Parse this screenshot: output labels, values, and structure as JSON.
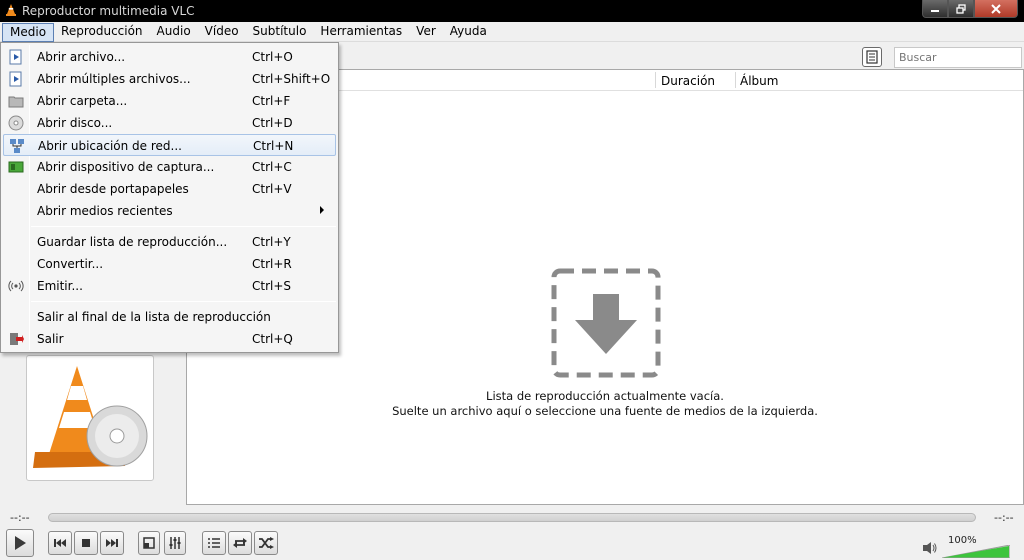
{
  "window": {
    "title": "Reproductor multimedia VLC"
  },
  "menubar": {
    "items": [
      "Medio",
      "Reproducción",
      "Audio",
      "Vídeo",
      "Subtítulo",
      "Herramientas",
      "Ver",
      "Ayuda"
    ],
    "active": "Medio"
  },
  "media_menu": {
    "items": [
      {
        "label": "Abrir archivo...",
        "shortcut": "Ctrl+O",
        "icon": "play-file-icon"
      },
      {
        "label": "Abrir múltiples archivos...",
        "shortcut": "Ctrl+Shift+O",
        "icon": "play-files-icon"
      },
      {
        "label": "Abrir carpeta...",
        "shortcut": "Ctrl+F",
        "icon": "folder-icon"
      },
      {
        "label": "Abrir disco...",
        "shortcut": "Ctrl+D",
        "icon": "disc-icon"
      },
      {
        "label": "Abrir ubicación de red...",
        "shortcut": "Ctrl+N",
        "icon": "network-icon",
        "highlighted": true
      },
      {
        "label": "Abrir dispositivo de captura...",
        "shortcut": "Ctrl+C",
        "icon": "capture-card-icon"
      },
      {
        "label": "Abrir desde portapapeles",
        "shortcut": "Ctrl+V",
        "icon": ""
      },
      {
        "label": "Abrir medios recientes",
        "shortcut": "",
        "icon": "",
        "submenu": true
      },
      {
        "label": "Guardar lista de reproducción...",
        "shortcut": "Ctrl+Y",
        "icon": ""
      },
      {
        "label": "Convertir...",
        "shortcut": "Ctrl+R",
        "icon": ""
      },
      {
        "label": "Emitir...",
        "shortcut": "Ctrl+S",
        "icon": "broadcast-icon"
      },
      {
        "label": "Salir al final de la lista de reproducción",
        "shortcut": "",
        "icon": ""
      },
      {
        "label": "Salir",
        "shortcut": "Ctrl+Q",
        "icon": "exit-icon"
      }
    ]
  },
  "toolbar": {
    "search_placeholder": "Buscar"
  },
  "playlist": {
    "columns": [
      "Duración",
      "Álbum"
    ],
    "empty_line1": "Lista de reproducción actualmente vacía.",
    "empty_line2": "Suelte un archivo aquí o seleccione una fuente de medios de la izquierda."
  },
  "player": {
    "elapsed": "--:--",
    "remaining": "--:--",
    "volume": "100%",
    "volume_level": 1.0
  },
  "colors": {
    "menu_highlight": "#d6e4f5",
    "volume_green": "#3cc43c",
    "cone_orange": "#f08a1c"
  }
}
